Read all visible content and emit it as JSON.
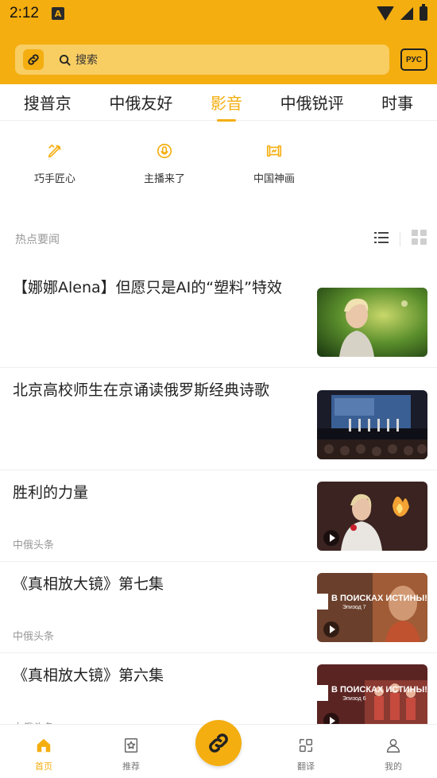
{
  "status_bar": {
    "time": "2:12",
    "app_icon": "A"
  },
  "header": {
    "search_placeholder": "搜索",
    "lang_button": "РУС",
    "brand_color": "#f4ae10"
  },
  "tabs": [
    {
      "label": "搜普京",
      "active": false
    },
    {
      "label": "中俄友好",
      "active": false
    },
    {
      "label": "影音",
      "active": true
    },
    {
      "label": "中俄锐评",
      "active": false
    },
    {
      "label": "时事",
      "active": false
    }
  ],
  "subcategories": [
    {
      "label": "巧手匠心",
      "icon": "craft-pen-icon"
    },
    {
      "label": "主播来了",
      "icon": "microphone-icon"
    },
    {
      "label": "中国神画",
      "icon": "scroll-icon"
    }
  ],
  "section": {
    "title": "热点要闻"
  },
  "news": [
    {
      "title": "【娜娜Alena】但愿只是AI的“塑料”特效",
      "source": "",
      "video": false
    },
    {
      "title": "北京高校师生在京诵读俄罗斯经典诗歌",
      "source": "",
      "video": false
    },
    {
      "title": "胜利的力量",
      "source": "中俄头条",
      "video": true
    },
    {
      "title": "《真相放大镜》第七集",
      "source": "中俄头条",
      "video": true,
      "thumb_text": "В ПОИСКАХ ИСТИНЫ!",
      "thumb_sub": "Эпизод 7"
    },
    {
      "title": "《真相放大镜》第六集",
      "source": "中俄头条",
      "video": true,
      "thumb_text": "В ПОИСКАХ ИСТИНЫ!",
      "thumb_sub": "Эпизод 6"
    }
  ],
  "bottom_nav": [
    {
      "label": "首页",
      "icon": "home-icon",
      "active": true
    },
    {
      "label": "推荐",
      "icon": "star-bookmark-icon",
      "active": false
    },
    {
      "label": "翻译",
      "icon": "translate-icon",
      "active": false
    },
    {
      "label": "我的",
      "icon": "user-icon",
      "active": false
    }
  ]
}
